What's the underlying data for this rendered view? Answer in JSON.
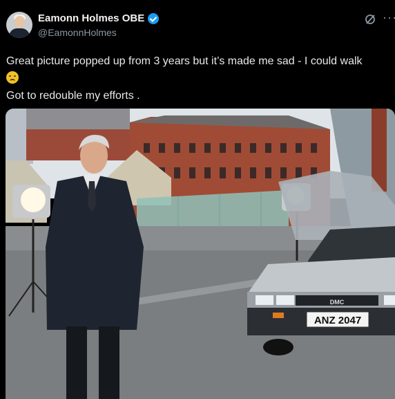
{
  "post": {
    "author_name": "Eamonn Holmes OBE",
    "author_handle": "@EamonnHolmes",
    "text_line1": "Great picture popped up from 3 years but it’s made me sad - I could walk",
    "emoji": "disappointed-face",
    "text_line3": "Got to redouble my efforts ."
  },
  "photo": {
    "car_badge": "DMC",
    "license_plate": "ANZ 2047"
  },
  "icons": {
    "verified": "verified-badge-icon",
    "grok": "grok-icon",
    "more": "more-options-icon"
  },
  "colors": {
    "background": "#000000",
    "verified": "#1d9bf0",
    "handle": "#8b98a5"
  }
}
